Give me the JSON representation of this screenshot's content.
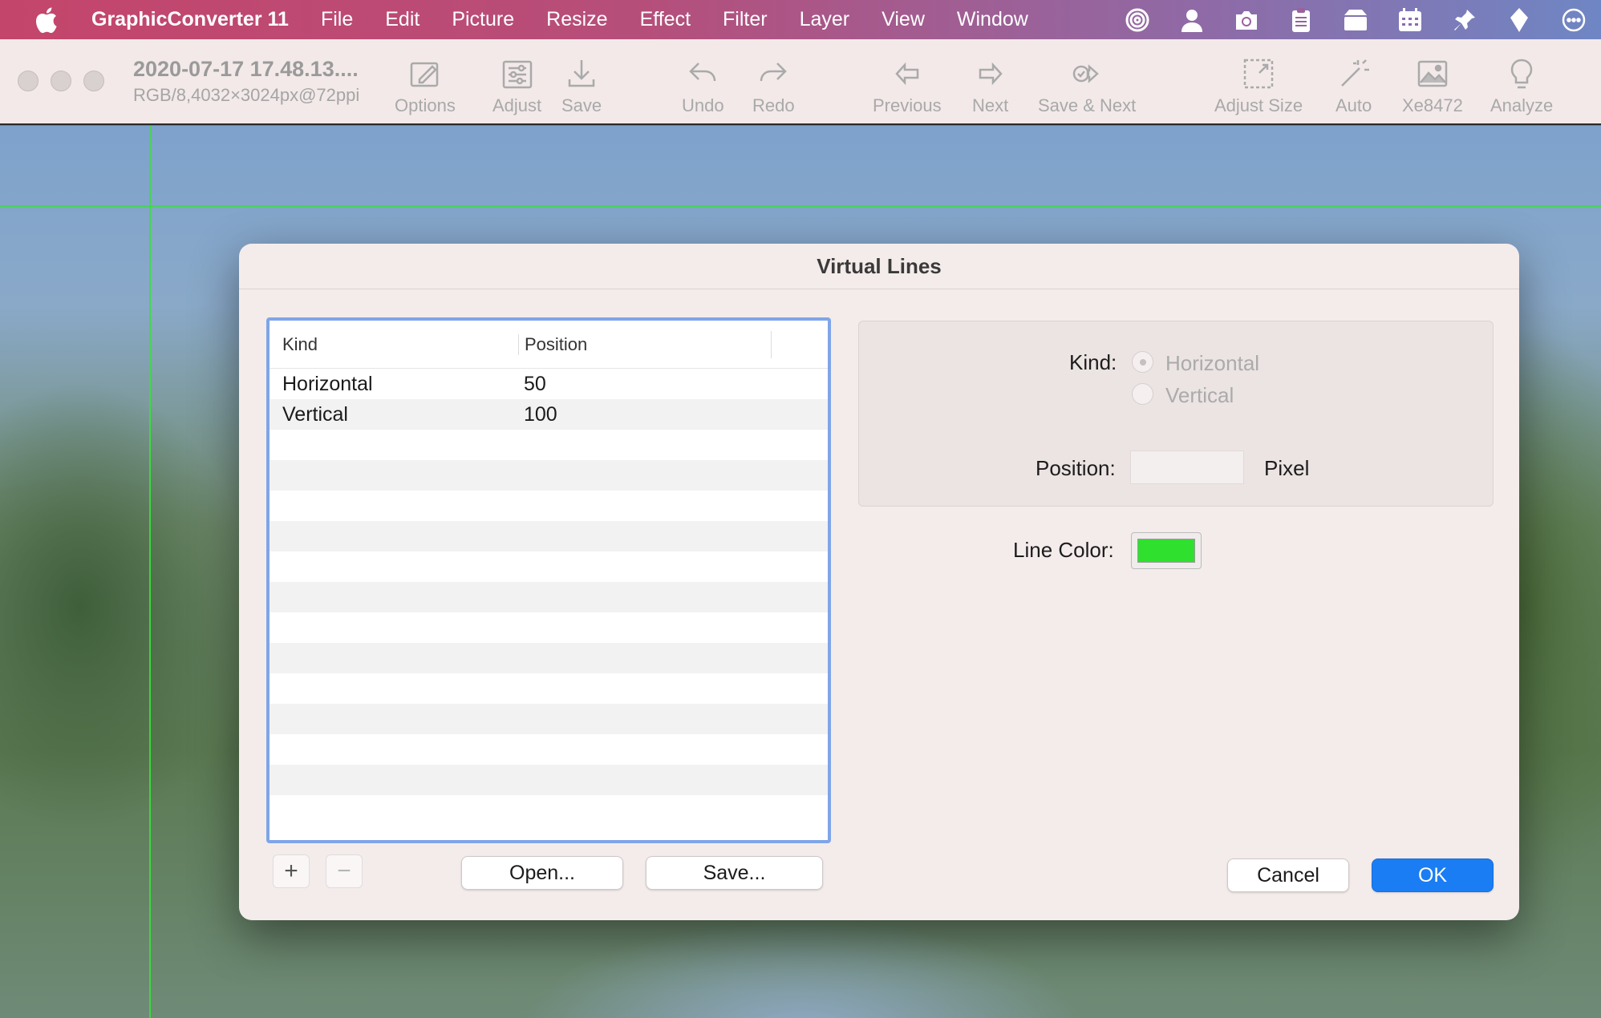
{
  "menubar": {
    "app_name": "GraphicConverter 11",
    "items": [
      "File",
      "Edit",
      "Picture",
      "Resize",
      "Effect",
      "Filter",
      "Layer",
      "View",
      "Window"
    ],
    "status_icons": [
      "target-icon",
      "user-icon",
      "camera-icon",
      "clipboard-icon",
      "box-icon",
      "calendar-icon",
      "pin-icon",
      "tag-icon",
      "ellipsis-icon"
    ]
  },
  "toolbar": {
    "doc_title": "2020-07-17 17.48.13....",
    "doc_info": "RGB/8,4032×3024px@72ppi",
    "buttons": {
      "options": "Options",
      "adjust": "Adjust",
      "save": "Save",
      "undo": "Undo",
      "redo": "Redo",
      "previous": "Previous",
      "next": "Next",
      "save_next": "Save & Next",
      "adjust_size": "Adjust Size",
      "auto": "Auto",
      "xe8472": "Xe8472",
      "analyze": "Analyze"
    }
  },
  "dialog": {
    "title": "Virtual Lines",
    "table": {
      "headers": {
        "kind": "Kind",
        "position": "Position"
      },
      "rows": [
        {
          "kind": "Horizontal",
          "position": "50"
        },
        {
          "kind": "Vertical",
          "position": "100"
        }
      ]
    },
    "add_symbol": "+",
    "remove_symbol": "−",
    "open_label": "Open...",
    "save_label": "Save...",
    "kind_label": "Kind:",
    "kind_options": {
      "horizontal": "Horizontal",
      "vertical": "Vertical"
    },
    "kind_selected": "Horizontal",
    "position_label": "Position:",
    "position_value": "",
    "position_unit": "Pixel",
    "line_color_label": "Line Color:",
    "line_color": "#2fe02f",
    "cancel_label": "Cancel",
    "ok_label": "OK"
  }
}
